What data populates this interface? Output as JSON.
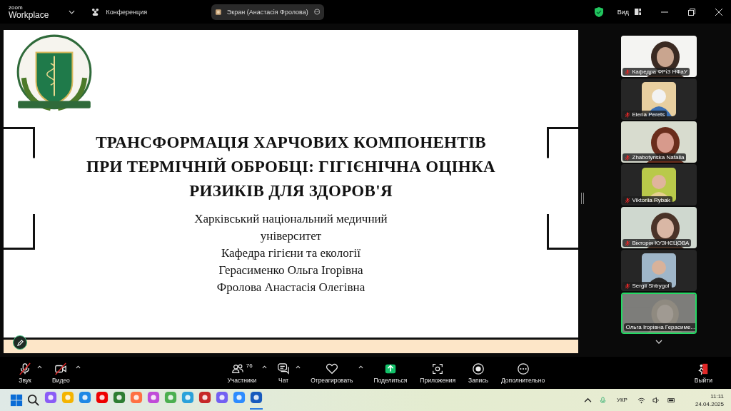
{
  "window": {
    "brand_small": "zoom",
    "brand": "Workplace",
    "meeting_label": "Конференция",
    "share_label": "Экран (Анастасія Фролова)",
    "view_label": "Вид"
  },
  "slide": {
    "title": "ТРАНСФОРМАЦІЯ ХАРЧОВИХ КОМПОНЕНТІВ ПРИ ТЕРМІЧНІЙ ОБРОБЦІ: ГІГІЄНІЧНА ОЦІНКА РИЗИКІВ ДЛЯ ЗДОРОВ'Я",
    "lines": [
      "Харківський національний медичний",
      "університет",
      "Кафедра гігієни та екології",
      "Герасименко Ольга Ігорівна",
      "Фролова Анастасія Олегівна"
    ]
  },
  "participants": [
    {
      "name": "Кафедра ФРіЗ НФаУ",
      "kind": "video",
      "muted": true,
      "selected": false
    },
    {
      "name": "Elena Perets",
      "kind": "avatar",
      "muted": true,
      "selected": false
    },
    {
      "name": "Zhabotynska Natalia",
      "kind": "video",
      "muted": true,
      "selected": false
    },
    {
      "name": "Viktoriia Rybak",
      "kind": "avatar",
      "muted": true,
      "selected": false
    },
    {
      "name": "Вікторія КУЗНЄЦОВА",
      "kind": "video",
      "muted": true,
      "selected": false
    },
    {
      "name": "Sergii Shtrygol",
      "kind": "avatar",
      "muted": true,
      "selected": false
    },
    {
      "name": "Ольга Ігорівна Герасиме...",
      "kind": "video",
      "muted": false,
      "selected": true
    }
  ],
  "toolbar": [
    {
      "kind": "mic",
      "label": "Звук",
      "off": true,
      "caret": true
    },
    {
      "kind": "video",
      "label": "Видео",
      "off": true,
      "caret": true
    },
    {
      "kind": "participants",
      "label": "Участники",
      "count": "76",
      "off": false,
      "caret": true
    },
    {
      "kind": "chat",
      "label": "Чат",
      "off": false,
      "caret": true
    },
    {
      "kind": "react",
      "label": "Отреагировать",
      "off": false,
      "caret": true
    },
    {
      "kind": "share",
      "label": "Поделиться",
      "off": false,
      "caret": false
    },
    {
      "kind": "apps",
      "label": "Приложения",
      "off": false,
      "caret": false
    },
    {
      "kind": "record",
      "label": "Запись",
      "off": false,
      "caret": false
    },
    {
      "kind": "more",
      "label": "Дополнительно",
      "off": false,
      "caret": false
    },
    {
      "kind": "leave",
      "label": "Выйти",
      "off": false,
      "caret": false
    }
  ],
  "taskbar": {
    "language": "УКР",
    "time": "11:11",
    "date": "24.04.2025"
  }
}
